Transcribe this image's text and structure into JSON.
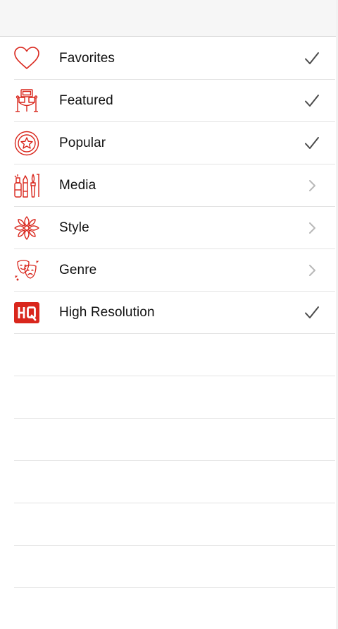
{
  "theme": {
    "accent": "#d9261c",
    "check": "#4a4a4a",
    "chevron": "#b8b8b8"
  },
  "list": {
    "items": [
      {
        "label": "Favorites",
        "icon": "heart-icon",
        "accessory": "checkmark-icon"
      },
      {
        "label": "Featured",
        "icon": "featured-stage-icon",
        "accessory": "checkmark-icon"
      },
      {
        "label": "Popular",
        "icon": "star-badge-icon",
        "accessory": "checkmark-icon"
      },
      {
        "label": "Media",
        "icon": "art-supplies-icon",
        "accessory": "chevron-right-icon"
      },
      {
        "label": "Style",
        "icon": "flower-icon",
        "accessory": "chevron-right-icon"
      },
      {
        "label": "Genre",
        "icon": "theater-masks-icon",
        "accessory": "chevron-right-icon"
      },
      {
        "label": "High Resolution",
        "icon": "hq-badge-icon",
        "accessory": "checkmark-icon"
      }
    ]
  }
}
